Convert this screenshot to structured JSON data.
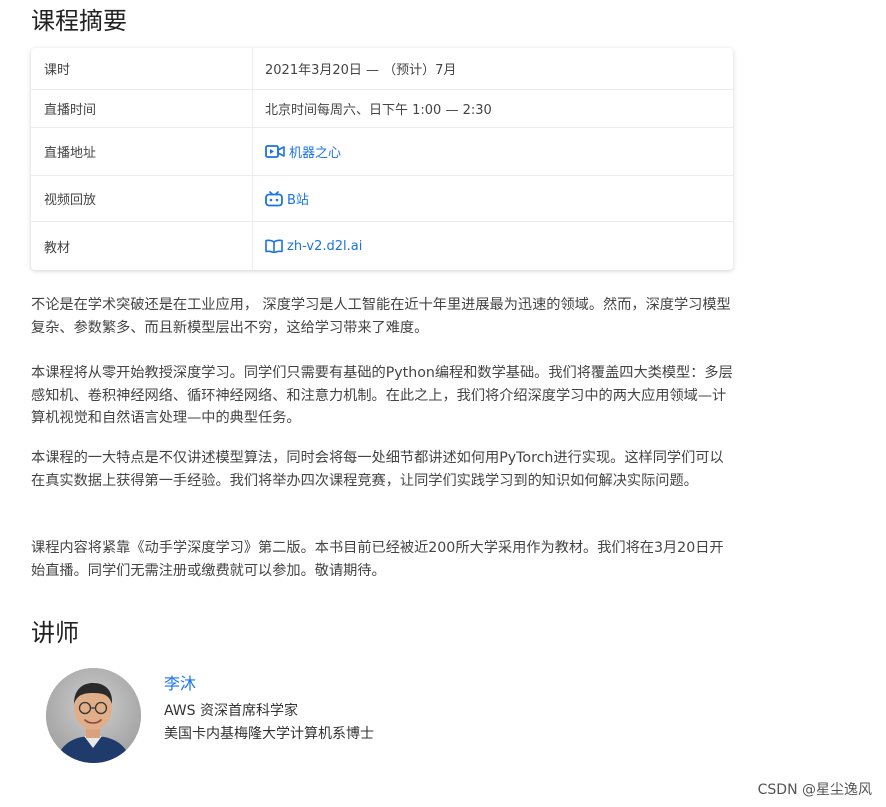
{
  "summary": {
    "title": "课程摘要",
    "rows": [
      {
        "label": "课时",
        "value": "2021年3月20日 — （预计）7月"
      },
      {
        "label": "直播时间",
        "value": "北京时间每周六、日下午 1:00 — 2:30"
      },
      {
        "label": "直播地址",
        "value": "机器之心",
        "icon": "video-camera-icon"
      },
      {
        "label": "视频回放",
        "value": "B站",
        "icon": "bilibili-tv-icon"
      },
      {
        "label": "教材",
        "value": "zh-v2.d2l.ai",
        "icon": "open-book-icon"
      }
    ],
    "accent_color": "#1a73e8"
  },
  "description": {
    "p1": "不论是在学术突破还是在工业应用， 深度学习是人工智能在近十年里进展最为迅速的领域。然而，深度学习模型复杂、参数繁多、而且新模型层出不穷，这给学习带来了难度。",
    "p2": "本课程将从零开始教授深度学习。同学们只需要有基础的Python编程和数学基础。我们将覆盖四大类模型：多层感知机、卷积神经网络、循环神经网络、和注意力机制。在此之上，我们将介绍深度学习中的两大应用领域—计算机视觉和自然语言处理—中的典型任务。",
    "p3": "本课程的一大特点是不仅讲述模型算法，同时会将每一处细节都讲述如何用PyTorch进行实现。这样同学们可以在真实数据上获得第一手经验。我们将举办四次课程竞赛，让同学们实践学习到的知识如何解决实际问题。",
    "p4": "课程内容将紧靠《动手学深度学习》第二版。本书目前已经被近200所大学采用作为教材。我们将在3月20日开始直播。同学们无需注册或缴费就可以参加。敬请期待。"
  },
  "instructor": {
    "section_title": "讲师",
    "name": "李沐",
    "title": "AWS 资深首席科学家",
    "degree": "美国卡内基梅隆大学计算机系博士"
  },
  "watermark": "CSDN @星尘逸风"
}
